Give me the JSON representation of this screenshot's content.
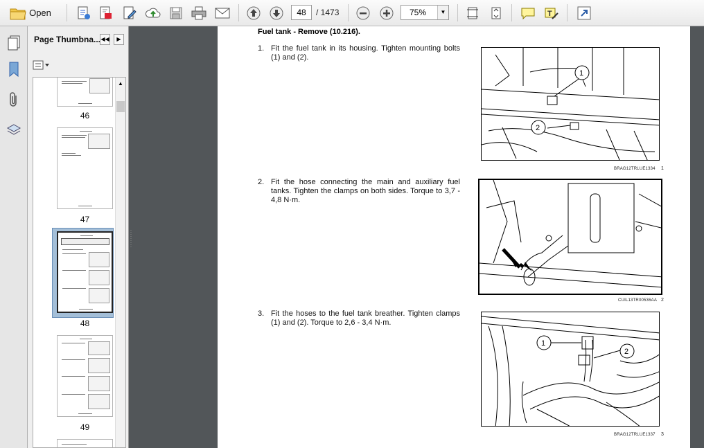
{
  "toolbar": {
    "open_label": "Open",
    "current_page": "48",
    "page_total": "/ 1473",
    "zoom": "75%"
  },
  "thumbnails": {
    "title": "Page Thumbna...",
    "pages": [
      "46",
      "47",
      "48",
      "49"
    ],
    "selected": "48"
  },
  "document": {
    "heading": "Fuel tank - Remove (10.216).",
    "steps": [
      {
        "num": "1.",
        "text": "Fit the fuel tank in its housing. Tighten mounting bolts (1) and (2).",
        "caption": "BRAG12TRLUE1334",
        "fig": "1"
      },
      {
        "num": "2.",
        "text": "Fit the hose connecting the main and auxiliary fuel tanks. Tighten the clamps on both sides. Torque to 3,7 - 4,8 N·m.",
        "caption": "CUIL13TR00536AA",
        "fig": "2"
      },
      {
        "num": "3.",
        "text": "Fit the hoses to the fuel tank breather. Tighten clamps (1) and (2). Torque to 2,6 - 3,4 N·m.",
        "caption": "BRAG12TRLUE1337",
        "fig": "3"
      }
    ],
    "callouts": [
      "1",
      "2",
      "1",
      "2"
    ]
  }
}
